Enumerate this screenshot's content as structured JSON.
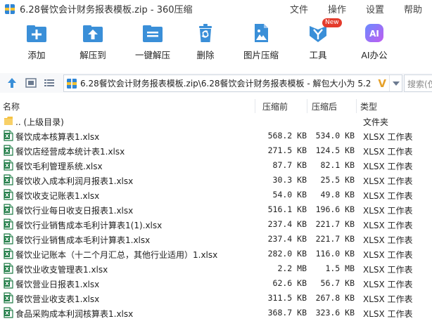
{
  "window": {
    "title": "6.28餐饮会计财务报表模板.zip - 360压缩",
    "menu": [
      "文件",
      "操作",
      "设置",
      "帮助"
    ]
  },
  "toolbar": {
    "items": [
      {
        "label": "添加",
        "icon": "add-icon"
      },
      {
        "label": "解压到",
        "icon": "extract-to-icon"
      },
      {
        "label": "一键解压",
        "icon": "one-click-extract-icon"
      },
      {
        "label": "删除",
        "icon": "trash-icon"
      },
      {
        "label": "图片压缩",
        "icon": "image-compress-icon"
      },
      {
        "label": "工具",
        "icon": "tools-icon",
        "badge": "New"
      },
      {
        "label": "AI办公",
        "icon": "ai-office-icon",
        "icon_text": "AI"
      }
    ]
  },
  "address": {
    "path": "6.28餐饮会计财务报表模板.zip\\6.28餐饮会计财务报表模板 - 解包大小为 5.2",
    "badge": "V",
    "search_placeholder": "搜索(仅"
  },
  "columns": {
    "name": "名称",
    "packed": "压缩前",
    "unpacked": "压缩后",
    "type": "类型"
  },
  "files": [
    {
      "name": ".. (上级目录)",
      "packed": "",
      "unpacked": "",
      "type": "文件夹",
      "kind": "folder"
    },
    {
      "name": "餐饮成本核算表1.xlsx",
      "packed": "568.2 KB",
      "unpacked": "534.0 KB",
      "type": "XLSX 工作表",
      "kind": "xlsx"
    },
    {
      "name": "餐饮店经营成本统计表1.xlsx",
      "packed": "271.5 KB",
      "unpacked": "124.5 KB",
      "type": "XLSX 工作表",
      "kind": "xlsx"
    },
    {
      "name": "餐饮毛利管理系统.xlsx",
      "packed": "87.7 KB",
      "unpacked": "82.1 KB",
      "type": "XLSX 工作表",
      "kind": "xlsx"
    },
    {
      "name": "餐饮收入成本利润月报表1.xlsx",
      "packed": "30.3 KB",
      "unpacked": "25.5 KB",
      "type": "XLSX 工作表",
      "kind": "xlsx"
    },
    {
      "name": "餐饮收支记账表1.xlsx",
      "packed": "54.0 KB",
      "unpacked": "49.8 KB",
      "type": "XLSX 工作表",
      "kind": "xlsx"
    },
    {
      "name": "餐饮行业每日收支日报表1.xlsx",
      "packed": "516.1 KB",
      "unpacked": "196.6 KB",
      "type": "XLSX 工作表",
      "kind": "xlsx"
    },
    {
      "name": "餐饮行业销售成本毛利计算表1(1).xlsx",
      "packed": "237.4 KB",
      "unpacked": "221.7 KB",
      "type": "XLSX 工作表",
      "kind": "xlsx"
    },
    {
      "name": "餐饮行业销售成本毛利计算表1.xlsx",
      "packed": "237.4 KB",
      "unpacked": "221.7 KB",
      "type": "XLSX 工作表",
      "kind": "xlsx"
    },
    {
      "name": "餐饮业记账本（十二个月汇总，其他行业适用）1.xlsx",
      "packed": "282.0 KB",
      "unpacked": "116.0 KB",
      "type": "XLSX 工作表",
      "kind": "xlsx"
    },
    {
      "name": "餐饮业收支管理表1.xlsx",
      "packed": "2.2 MB",
      "unpacked": "1.5 MB",
      "type": "XLSX 工作表",
      "kind": "xlsx"
    },
    {
      "name": "餐饮营业日报表1.xlsx",
      "packed": "62.6 KB",
      "unpacked": "56.7 KB",
      "type": "XLSX 工作表",
      "kind": "xlsx"
    },
    {
      "name": "餐饮营业收支表1.xlsx",
      "packed": "311.5 KB",
      "unpacked": "267.8 KB",
      "type": "XLSX 工作表",
      "kind": "xlsx"
    },
    {
      "name": "食品采购成本利润核算表1.xlsx",
      "packed": "368.7 KB",
      "unpacked": "323.6 KB",
      "type": "XLSX 工作表",
      "kind": "xlsx"
    }
  ],
  "colors": {
    "accent": "#2f86d6",
    "icon_blue": "#3a8fd8",
    "xlsx_green": "#1e7b45",
    "folder_yellow": "#f5c242",
    "new_badge": "#e43b2c"
  }
}
